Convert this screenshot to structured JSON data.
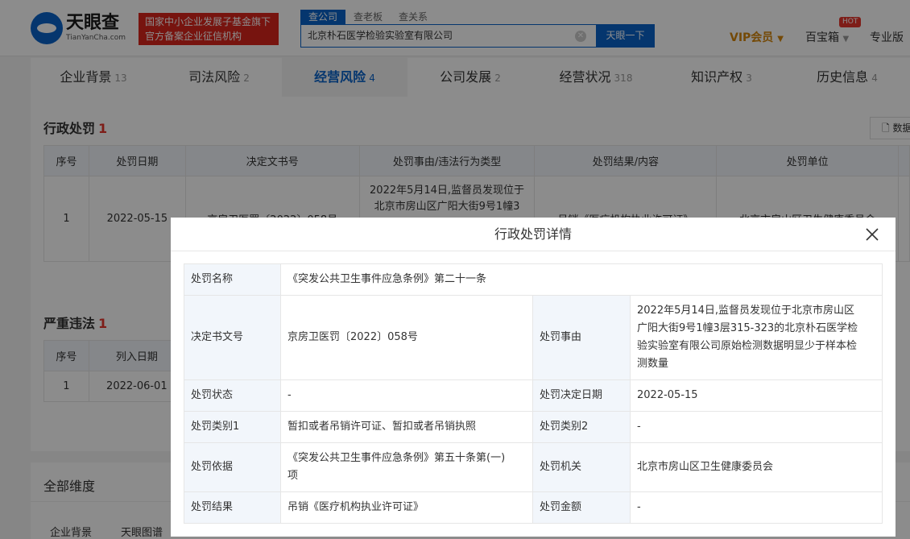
{
  "header": {
    "logo_cn": "天眼查",
    "logo_en": "TianYanCha.com",
    "slogan_line1": "国家中小企业发展子基金旗下",
    "slogan_line2": "官方备案企业征信机构",
    "search_tabs": [
      "查公司",
      "查老板",
      "查关系"
    ],
    "search_value": "北京朴石医学检验实验室有限公司",
    "search_button": "天眼一下",
    "vip": "VIP会员",
    "baibao": "百宝箱",
    "hot": "HOT",
    "pro": "专业版"
  },
  "nav": [
    {
      "label": "企业背景",
      "count": "13"
    },
    {
      "label": "司法风险",
      "count": "2"
    },
    {
      "label": "经营风险",
      "count": "4"
    },
    {
      "label": "公司发展",
      "count": "2"
    },
    {
      "label": "经营状况",
      "count": "318"
    },
    {
      "label": "知识产权",
      "count": "3"
    },
    {
      "label": "历史信息",
      "count": "4"
    }
  ],
  "admin_penalty": {
    "title": "行政处罚",
    "count": "1",
    "data_button": "数据",
    "headers": [
      "序号",
      "处罚日期",
      "决定文书号",
      "处罚事由/违法行为类型",
      "处罚结果/内容",
      "处罚单位"
    ],
    "row": {
      "index": "1",
      "date": "2022-05-15",
      "doc": "京房卫医罚〔2022〕058号",
      "reason_line1": "2022年5月14日,监督员发现位于",
      "reason_line2": "北京市房山区广阳大街9号1幢3",
      "result": "吊销《医疗机构执业许可证》",
      "unit": "北京市房山区卫生健康委员会"
    }
  },
  "serious": {
    "title": "严重违法",
    "count": "1",
    "headers": [
      "序号",
      "列入日期"
    ],
    "row": {
      "index": "1",
      "date": "2022-06-01"
    }
  },
  "full": {
    "title": "全部维度",
    "tabs": [
      "企业背景",
      "天眼图谱"
    ]
  },
  "modal": {
    "title": "行政处罚详情",
    "name_label": "处罚名称",
    "name_value": "《突发公共卫生事件应急条例》第二十一条",
    "doc_label": "决定书文号",
    "doc_value": "京房卫医罚〔2022〕058号",
    "reason_label": "处罚事由",
    "reason_line1": "2022年5月14日,监督员发现位于北京市房山区",
    "reason_line2": "广阳大街9号1幢3层315-323的北京朴石医学检",
    "reason_line3": "验实验室有限公司原始检测数据明显少于样本检",
    "reason_line4": "测数量",
    "status_label": "处罚状态",
    "status_value": "-",
    "decision_date_label": "处罚决定日期",
    "decision_date_value": "2022-05-15",
    "type1_label": "处罚类别1",
    "type1_value": "暂扣或者吊销许可证、暂扣或者吊销执照",
    "type2_label": "处罚类别2",
    "type2_value": "-",
    "basis_label": "处罚依据",
    "basis_line1": "《突发公共卫生事件应急条例》第五十条第(一)",
    "basis_line2": "项",
    "authority_label": "处罚机关",
    "authority_value": "北京市房山区卫生健康委员会",
    "result_label": "处罚结果",
    "result_value": "吊销《医疗机构执业许可证》",
    "amount_label": "处罚金额",
    "amount_value": "-"
  }
}
